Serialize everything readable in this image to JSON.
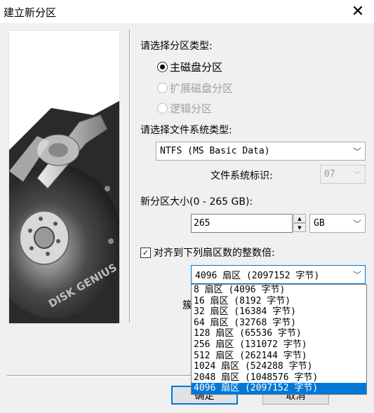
{
  "window": {
    "title": "建立新分区"
  },
  "partition_type": {
    "label": "请选择分区类型:",
    "options": [
      {
        "label": "主磁盘分区",
        "checked": true,
        "disabled": false
      },
      {
        "label": "扩展磁盘分区",
        "checked": false,
        "disabled": true
      },
      {
        "label": "逻辑分区",
        "checked": false,
        "disabled": true
      }
    ]
  },
  "filesystem": {
    "label": "请选择文件系统类型:",
    "value": "NTFS (MS Basic Data)",
    "id_label": "文件系统标识:",
    "id_value": "07"
  },
  "size": {
    "label": "新分区大小(0 - 265 GB):",
    "value": "265",
    "unit": "GB"
  },
  "align": {
    "label": "对齐到下列扇区数的整数倍:",
    "checked": true,
    "value": "4096 扇区 (2097152 字节)",
    "options": [
      "8 扇区 (4096 字节)",
      "16 扇区 (8192 字节)",
      "32 扇区 (16384 字节)",
      "64 扇区 (32768 字节)",
      "128 扇区 (65536 字节)",
      "256 扇区 (131072 字节)",
      "512 扇区 (262144 字节)",
      "1024 扇区 (524288 字节)",
      "2048 扇区 (1048576 字节)",
      "4096 扇区 (2097152 字节)"
    ],
    "selected_index": 9
  },
  "partial_label": "簇",
  "buttons": {
    "ok": "确定",
    "cancel": "取消"
  },
  "image": {
    "brand_text": "DISK GENIUS"
  },
  "colors": {
    "accent": "#0078d7"
  }
}
